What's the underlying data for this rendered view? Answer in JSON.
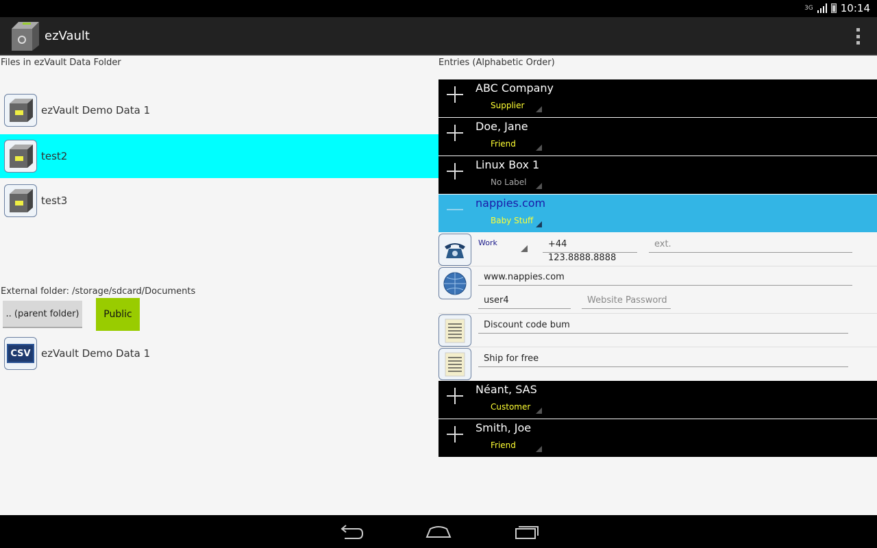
{
  "status": {
    "network": "3G",
    "time": "10:14"
  },
  "app": {
    "title": "ezVault"
  },
  "left": {
    "section_label": "Files in ezVault Data Folder",
    "files": [
      {
        "name": "ezVault Demo Data 1",
        "selected": false
      },
      {
        "name": "test2",
        "selected": true
      },
      {
        "name": "test3",
        "selected": false
      }
    ],
    "external_label": "External folder: /storage/sdcard/Documents",
    "parent_button": ".. (parent folder)",
    "public_button": "Public",
    "csv_icon_text": "CSV",
    "external_files": [
      {
        "name": "ezVault Demo Data 1"
      }
    ]
  },
  "right": {
    "section_label": "Entries (Alphabetic Order)",
    "entries_top": [
      {
        "name": "ABC Company",
        "tag": "Supplier"
      },
      {
        "name": "Doe, Jane",
        "tag": "Friend"
      },
      {
        "name": "Linux Box 1",
        "tag": "No Label"
      }
    ],
    "active_entry": {
      "name": "nappies.com",
      "tag": "Baby Stuff"
    },
    "phone": {
      "type": "Work",
      "number": "+44 123.8888.8888",
      "ext_placeholder": "ext."
    },
    "web": {
      "url": "www.nappies.com",
      "user": "user4",
      "password_placeholder": "Website Password"
    },
    "notes": [
      "Discount code bum",
      "Ship for free"
    ],
    "entries_bottom": [
      {
        "name": "Néant, SAS",
        "tag": "Customer"
      },
      {
        "name": "Smith, Joe",
        "tag": "Friend"
      }
    ]
  },
  "colors": {
    "accent": "#33b5e5",
    "selected_file": "#00ffff",
    "public_button": "#99cc00",
    "tag_text": "#ffff33"
  }
}
